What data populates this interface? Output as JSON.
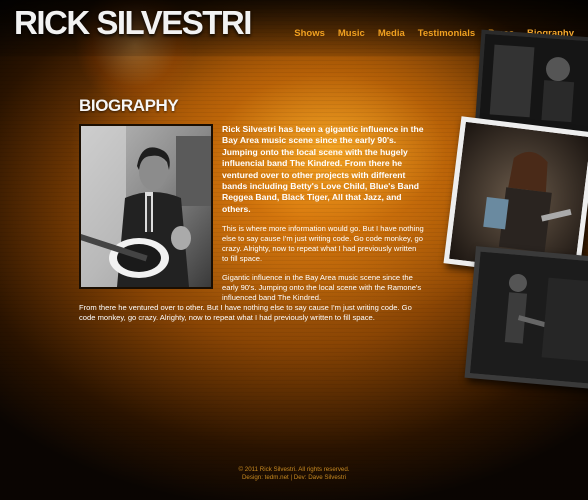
{
  "header": {
    "site_title": "RICK SILVESTRI",
    "nav": [
      {
        "label": "Shows",
        "active": false
      },
      {
        "label": "Music",
        "active": false
      },
      {
        "label": "Media",
        "active": false
      },
      {
        "label": "Testimonials",
        "active": false
      },
      {
        "label": "Press",
        "active": false
      },
      {
        "label": "Biography",
        "active": true
      }
    ]
  },
  "main": {
    "heading": "BIOGRAPHY",
    "lead_paragraph": "Rick Silvestri has been a gigantic influence in the Bay Area music scene since the early 90's. Jumping onto the local scene with the hugely influencial band The Kindred. From there he ventured over to other projects with different bands including Betty's Love Child, Blue's Band Reggea Band, Black Tiger, All that Jazz, and others.",
    "paragraph_2": "This is where more information would go. But I have nothing else to say cause I'm just writing code. Go code monkey, go crazy. Alrighty, now to repeat what I had previously written to fill space.",
    "paragraph_3_a": "Gigantic influence in the Bay Area music scene since the early 90's. Jumping onto the local scene with the Ramone's influenced band The Kindred.",
    "paragraph_3_b": "From there he ventured over to other. But I have nothing else to say cause I'm just writing code. Go code monkey, go crazy. Alrighty, now to repeat what I had previously written to fill space."
  },
  "footer": {
    "copyright": "© 2011 Rick Silvestri. All rights reserved.",
    "credits": "Design: tedm.net | Dev: Dave Silvestri"
  },
  "colors": {
    "accent": "#f0a020",
    "background": "#8a4504",
    "text": "#ffffff"
  }
}
